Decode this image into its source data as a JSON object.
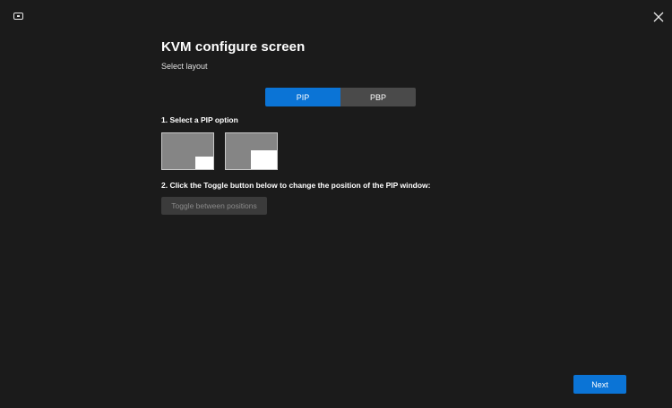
{
  "header": {
    "title": "KVM configure screen",
    "subtitle": "Select layout"
  },
  "layout_tabs": {
    "pip_label": "PIP",
    "pbp_label": "PBP",
    "selected": "PIP"
  },
  "step1": {
    "label": "1. Select a PIP option"
  },
  "pip_options": [
    "pip-small",
    "pip-large"
  ],
  "step2": {
    "label": "2. Click the Toggle button below to change the position of the PIP window:"
  },
  "toggle": {
    "label": "Toggle between positions"
  },
  "footer": {
    "next_label": "Next"
  },
  "colors": {
    "background": "#1b1b1b",
    "accent": "#0b74d6",
    "inactive_tab": "#4a4a4a",
    "disabled_button": "#3b3b3b",
    "thumb_fill": "#858585"
  },
  "icons": {
    "app": "monitor-icon",
    "close": "close-icon"
  }
}
